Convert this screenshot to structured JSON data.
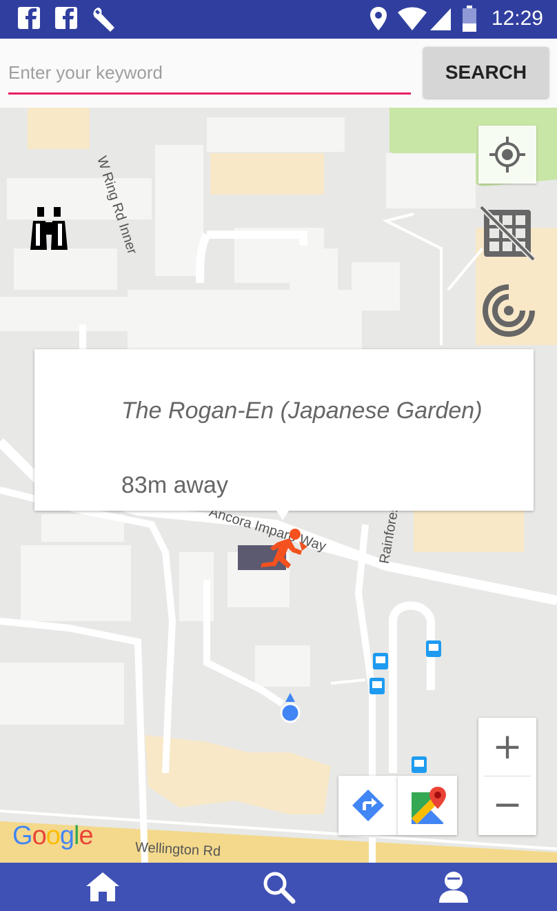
{
  "status_bar": {
    "time": "12:29",
    "icons": [
      "facebook-icon",
      "facebook-icon",
      "wrench-icon",
      "location-icon",
      "wifi-icon",
      "signal-icon",
      "battery-icon"
    ],
    "background": "#303f9f"
  },
  "search": {
    "placeholder": "Enter your keyword",
    "value": "",
    "button_label": "SEARCH",
    "accent": "#e91e63"
  },
  "map": {
    "street_labels": [
      "W Ring Rd Inner",
      "Wellington Rd",
      "Ancora Imparo Way",
      "Rainforest Walk"
    ],
    "controls": [
      "my-location-icon",
      "grid-off-icon",
      "radar-icon",
      "binoculars-icon"
    ],
    "zoom_in": "+",
    "zoom_out": "−",
    "toolbar": [
      "directions-icon",
      "google-maps-icon"
    ],
    "logo": "Google"
  },
  "info_window": {
    "title": "The Rogan-En (Japanese Garden)",
    "distance": "83m away"
  },
  "bottom_nav": {
    "items": [
      "home-icon",
      "search-icon",
      "profile-icon"
    ],
    "background": "#3f51b5"
  }
}
